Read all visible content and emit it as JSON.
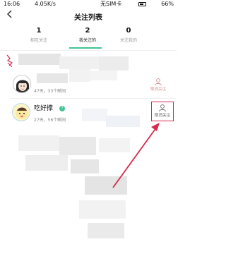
{
  "status_bar": {
    "time": "16:06",
    "network_speed": "4.05K/s",
    "carrier": "无SIM卡",
    "battery": "66%"
  },
  "header": {
    "back_icon": "chevron-left-icon",
    "title": "关注列表"
  },
  "tabs": [
    {
      "count": "1",
      "label": "相互关注",
      "active": false
    },
    {
      "count": "2",
      "label": "我关注的",
      "active": true
    },
    {
      "count": "0",
      "label": "关注我的",
      "active": false
    }
  ],
  "list": [
    {
      "name": "",
      "meta": "47天，33个瞬间",
      "follow_label": "取消关注"
    },
    {
      "name": "吃好撑",
      "meta": "27天，56个瞬间",
      "follow_label": "取消关注"
    }
  ],
  "colors": {
    "accent": "#3fc491",
    "highlight": "#d8284b"
  }
}
